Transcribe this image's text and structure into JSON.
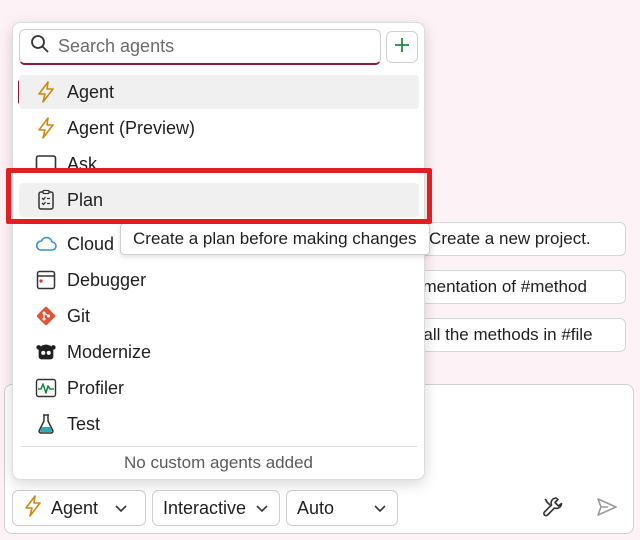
{
  "suggestions": [
    "S Create a new project.",
    "ementation of #method",
    "r all the methods in #file"
  ],
  "popup": {
    "search_placeholder": "Search agents",
    "items": [
      {
        "label": "Agent",
        "icon": "lightning-icon"
      },
      {
        "label": "Agent (Preview)",
        "icon": "lightning-icon"
      },
      {
        "label": "Ask",
        "icon": "chat-icon"
      },
      {
        "label": "Plan",
        "icon": "clipboard-checklist-icon"
      },
      {
        "label": "Cloud",
        "icon": "cloud-icon"
      },
      {
        "label": "Debugger",
        "icon": "debugger-window-icon"
      },
      {
        "label": "Git",
        "icon": "git-icon"
      },
      {
        "label": "Modernize",
        "icon": "modernize-bot-icon"
      },
      {
        "label": "Profiler",
        "icon": "profiler-pulse-icon"
      },
      {
        "label": "Test",
        "icon": "flask-icon"
      }
    ],
    "footer": "No custom agents added"
  },
  "tooltip": "Create a plan before making changes",
  "bottom_bar": {
    "agent_label": "Agent",
    "interactive_label": "Interactive",
    "auto_label": "Auto"
  },
  "colors": {
    "accent": "#8b1a3d",
    "highlight": "#e01e24",
    "lightning": "#c98a12",
    "cloud": "#3a8fd6",
    "git": "#e0553a",
    "profiler": "#1f8a43",
    "add": "#1f8a43"
  }
}
